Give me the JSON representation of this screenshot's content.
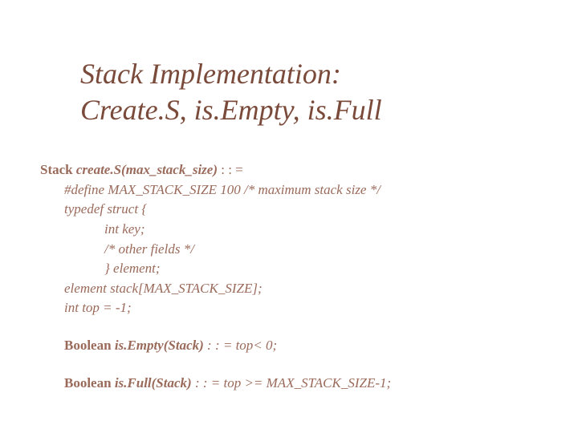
{
  "title_line1": "Stack  Implementation:",
  "title_line2": "Create.S, is.Empty, is.Full",
  "lines": {
    "l1a": "Stack ",
    "l1b": "create.S(max_stack_size)",
    "l1c": " : : =",
    "l2": "#define MAX_STACK_SIZE 100 /* maximum stack size */",
    "l3": "typedef struct {",
    "l4": "int key;",
    "l5": "/* other fields */",
    "l6": "} element;",
    "l7": "element stack[MAX_STACK_SIZE];",
    "l8": "int top = -1;",
    "l9a": "Boolean ",
    "l9b": "is.Empty(Stack)",
    "l9c": " : : = top< 0;",
    "l10a": "Boolean ",
    "l10b": "is.Full(Stack)",
    "l10c": " : : = top >= MAX_STACK_SIZE-1;"
  }
}
